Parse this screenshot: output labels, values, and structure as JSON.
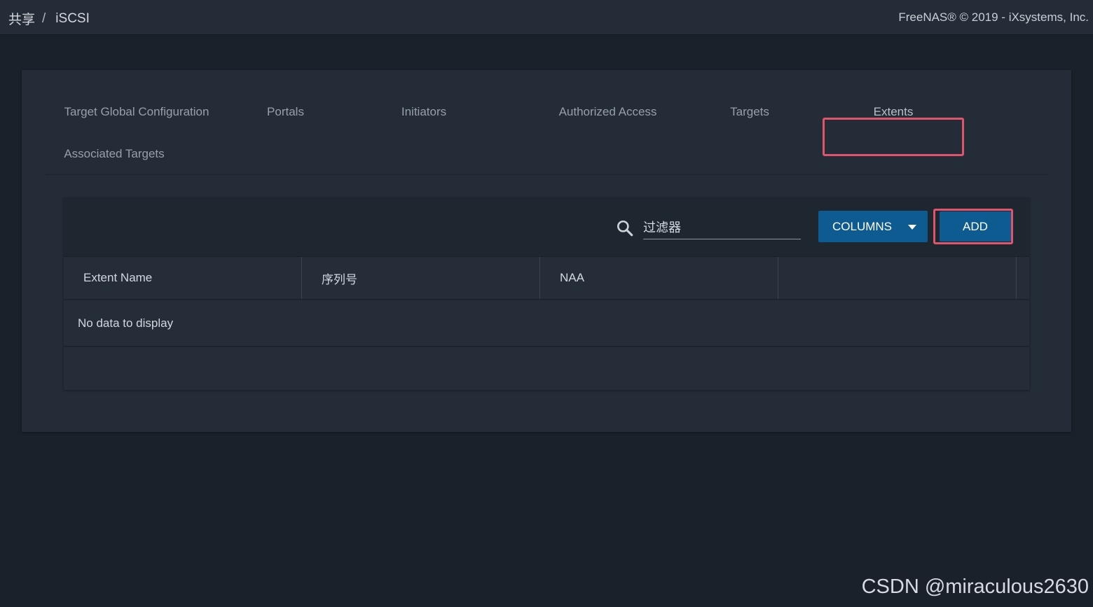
{
  "header": {
    "breadcrumb": [
      "共享",
      "/",
      "iSCSI"
    ],
    "copyright": "FreeNAS® © 2019 - iXsystems, Inc."
  },
  "tabs": [
    {
      "label": "Target Global Configuration",
      "active": false
    },
    {
      "label": "Portals",
      "active": false
    },
    {
      "label": "Initiators",
      "active": false
    },
    {
      "label": "Authorized Access",
      "active": false
    },
    {
      "label": "Targets",
      "active": false
    },
    {
      "label": "Extents",
      "active": true
    },
    {
      "label": "Associated Targets",
      "active": false
    }
  ],
  "toolbar": {
    "filter_placeholder": "过滤器",
    "columns_label": "COLUMNS",
    "add_label": "ADD"
  },
  "table": {
    "columns": [
      "Extent Name",
      "序列号",
      "NAA",
      ""
    ],
    "empty_message": "No data to display"
  },
  "watermark": "CSDN @miraculous2630",
  "colors": {
    "accent": "#0e5b91",
    "highlight": "#e2546b",
    "background": "#1b212a",
    "card": "#232c37"
  }
}
